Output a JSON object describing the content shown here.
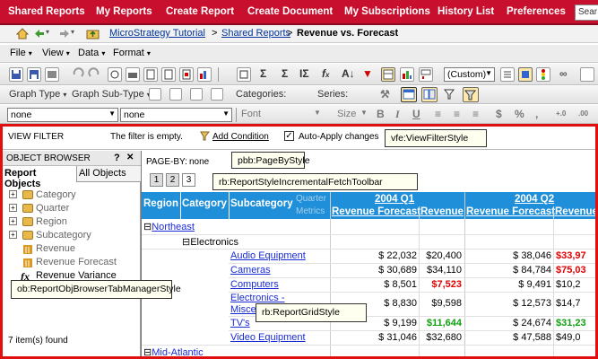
{
  "topnav": {
    "items": [
      "Shared Reports",
      "My Reports",
      "Create Report",
      "Create Document",
      "My Subscriptions",
      "History List",
      "Preferences"
    ],
    "search_text": "Sear"
  },
  "breadcrumb": {
    "project": "MicroStrategy Tutorial",
    "folder": "Shared Reports",
    "current": "Revenue vs. Forecast",
    "sep": ">"
  },
  "menubar": {
    "items": [
      "File",
      "View",
      "Data",
      "Format"
    ]
  },
  "toolbar1": {
    "custom_select": "(Custom)"
  },
  "toolbar2": {
    "graph_type": "Graph Type",
    "graph_subtype": "Graph Sub-Type",
    "categories_label": "Categories:",
    "series_label": "Series:"
  },
  "toolbar3": {
    "select1": "none",
    "select2": "none",
    "font_label": "Font",
    "size_label": "Size",
    "bold": "B",
    "italic": "I",
    "underline": "U",
    "currency": "$",
    "percent": "%",
    "comma": ",",
    "inc_decimal": "+.0",
    "dec_decimal": ".00"
  },
  "viewfilter": {
    "title": "VIEW FILTER",
    "status": "The filter is empty.",
    "add_condition": "Add Condition",
    "auto_apply": "Auto-Apply changes",
    "style_label": "vfe:ViewFilterStyle"
  },
  "objbrowser": {
    "title": "OBJECT BROWSER",
    "help": "?",
    "close": "✕",
    "tabs": [
      "Report Objects",
      "All Objects"
    ],
    "attributes": [
      "Category",
      "Quarter",
      "Region",
      "Subcategory"
    ],
    "metrics": [
      "Revenue",
      "Revenue Forecast",
      "Revenue Variance"
    ],
    "status": "7 item(s) found",
    "style_label": "ob:ReportObjBrowserTabManagerStyle"
  },
  "pageby": {
    "label": "PAGE-BY:",
    "value": "none",
    "style_label": "pbb:PageByStyle"
  },
  "toolbar_incremental": {
    "pages": [
      "1",
      "2",
      "3"
    ],
    "style_label": "rb:ReportStyleIncrementalFetchToolbar"
  },
  "grid": {
    "style_label": "rb:ReportGridStyle",
    "headers": {
      "region": "Region",
      "category": "Category",
      "subcategory": "Subcategory",
      "quarter": "Quarter",
      "metrics": "Metrics",
      "q1": "2004 Q1",
      "q2": "2004 Q2",
      "revenue_forecast": "Revenue Forecast",
      "revenue": "Revenue",
      "expand_icon": "⊟"
    },
    "region_rows": [
      "Northeast",
      "Mid-Atlantic"
    ],
    "category": "Electronics",
    "rows": [
      {
        "subcat": "Audio Equipment",
        "q1f": "$ 22,032",
        "q1r": "$20,400",
        "q2f": "$ 38,046",
        "q2r": "$33,97"
      },
      {
        "subcat": "Cameras",
        "q1f": "$ 30,689",
        "q1r": "$34,110",
        "q2f": "$ 84,784",
        "q2r": "$75,03"
      },
      {
        "subcat": "Computers",
        "q1f": "$ 8,501",
        "q1r": "$7,523",
        "q2f": "$ 9,491",
        "q2r": "$10,2"
      },
      {
        "subcat_l1": "Electronics -",
        "subcat_l2": "Miscel",
        "q1f": "$ 8,830",
        "q1r": "$9,598",
        "q2f": "$ 12,573",
        "q2r": "$14,7"
      },
      {
        "subcat": "TV's",
        "q1f": "$ 9,199",
        "q1r": "$11,644",
        "q2f": "$ 24,674",
        "q2r": "$31,23"
      },
      {
        "subcat": "Video Equipment",
        "q1f": "$ 31,046",
        "q1r": "$32,680",
        "q2f": "$ 47,588",
        "q2r": "$49,0"
      }
    ]
  },
  "colors": {
    "nav_red": "#c8102e",
    "grid_header": "#1e8fd8",
    "highlight_frame": "#e01010",
    "below_forecast": "#e00000",
    "above_forecast": "#11a011"
  }
}
